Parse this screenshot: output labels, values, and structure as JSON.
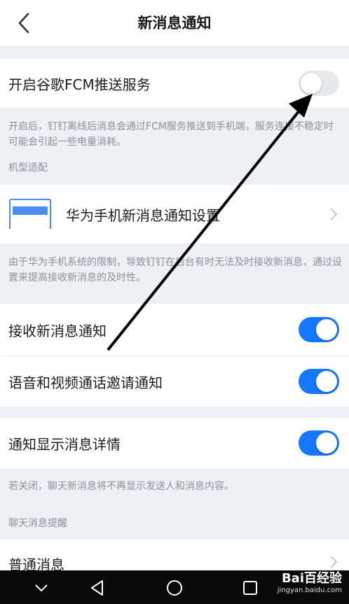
{
  "header": {
    "title": "新消息通知"
  },
  "fcm": {
    "label": "开启谷歌FCM推送服务",
    "enabled": false,
    "note": "开启后，钉钉离线后消息会通过FCM服务推送到手机端，服务连接不稳定时可能会引起一些电量消耗。"
  },
  "model_section": {
    "label": "机型适配",
    "huawei_label": "华为手机新消息通知设置",
    "huawei_note": "由于华为手机系统的限制，导致钉钉在后台有时无法及时接收新消息，通过设置来提高接收新消息的及时性。"
  },
  "toggles": {
    "receive_label": "接收新消息通知",
    "receive_on": true,
    "call_label": "语音和视频通话邀请通知",
    "call_on": true,
    "detail_label": "通知显示消息详情",
    "detail_on": true,
    "detail_note": "若关闭，聊天新消息将不再显示发送人和消息内容。"
  },
  "chat_section": {
    "label": "聊天消息提醒",
    "normal_label": "普通消息"
  },
  "watermark": {
    "text": "Bai百经验",
    "sub": "jingyan.baidu.com"
  },
  "colors": {
    "accent": "#1677ff",
    "background": "#eef0f4",
    "note_text": "#8b8f99"
  }
}
